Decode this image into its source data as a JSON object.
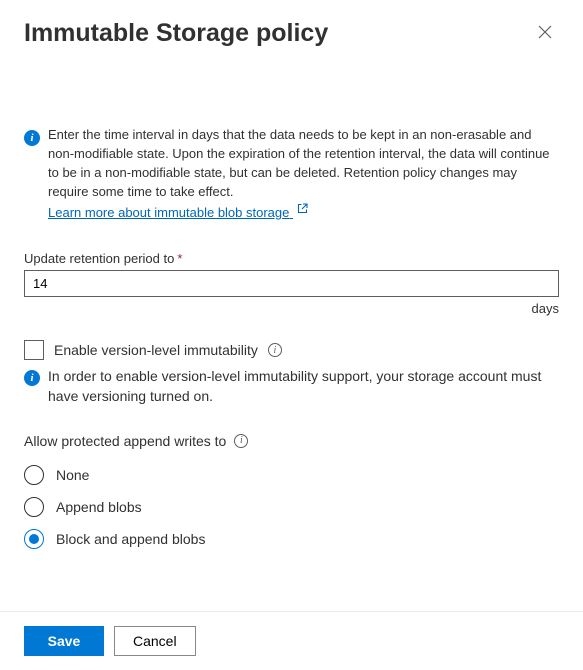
{
  "header": {
    "title": "Immutable Storage policy"
  },
  "info": {
    "text": "Enter the time interval in days that the data needs to be kept in an non-erasable and non-modifiable state. Upon the expiration of the retention interval, the data will continue to be in a non-modifiable state, but can be deleted. Retention policy changes may require some time to take effect.",
    "link_text": "Learn more about immutable blob storage"
  },
  "retention": {
    "label": "Update retention period to",
    "value": "14",
    "units": "days"
  },
  "version_level": {
    "checkbox_label": "Enable version-level immutability",
    "note": "In order to enable version-level immutability support, your storage account must have versioning turned on."
  },
  "append_writes": {
    "label": "Allow protected append writes to",
    "options": {
      "none": "None",
      "append": "Append blobs",
      "block_append": "Block and append blobs"
    },
    "selected": "block_append"
  },
  "footer": {
    "save": "Save",
    "cancel": "Cancel"
  }
}
